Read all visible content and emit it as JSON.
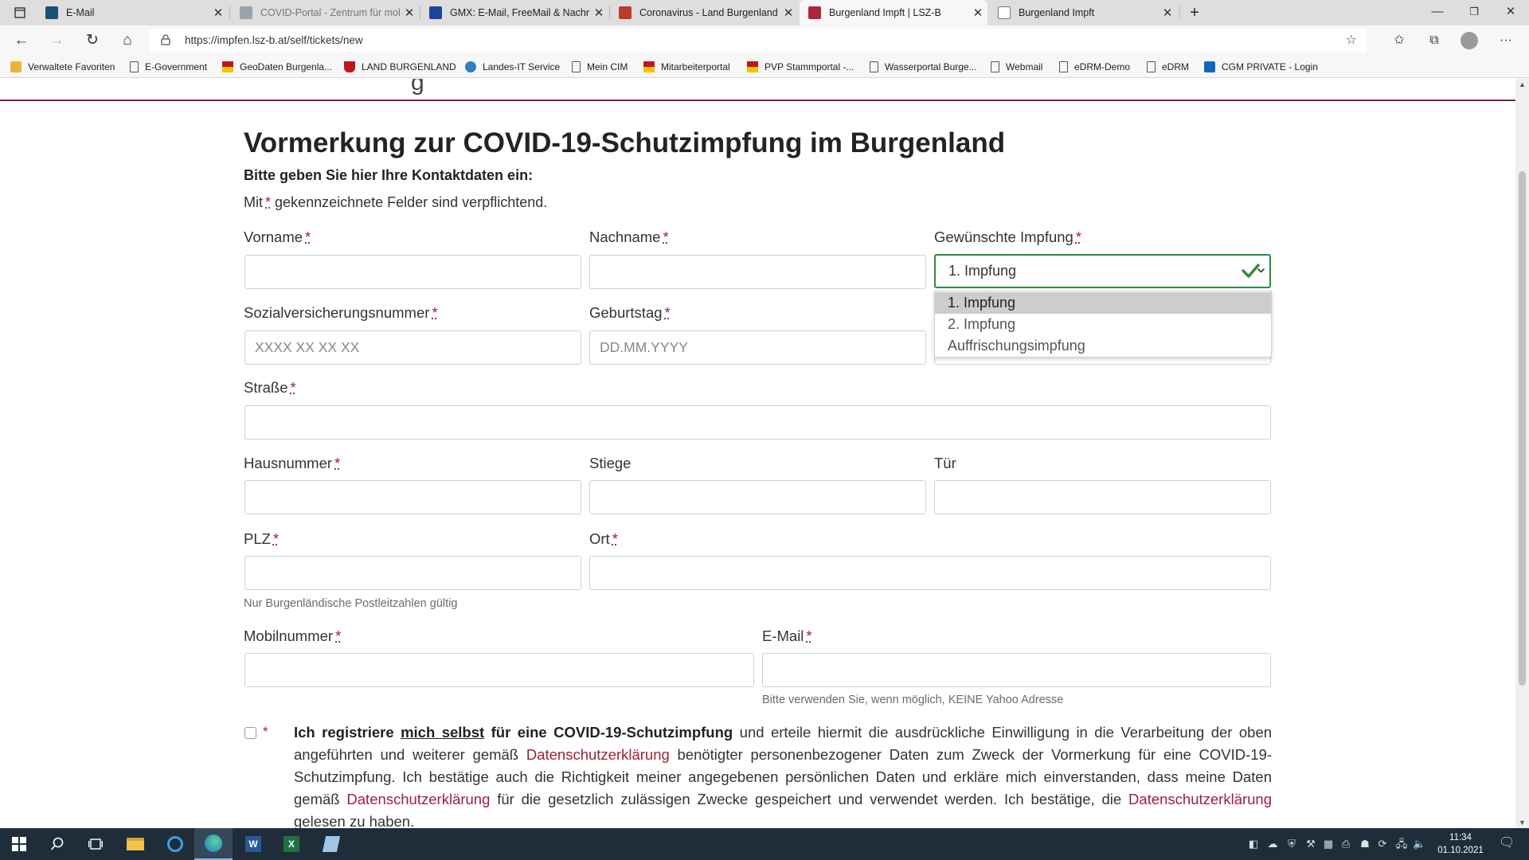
{
  "browser": {
    "tabs": [
      {
        "title": "E-Mail",
        "fav": "#1a5276"
      },
      {
        "title": "COVID-Portal - Zentrum für mol",
        "fav": "#9aa3ad"
      },
      {
        "title": "GMX: E-Mail, FreeMail & Nachric",
        "fav": "#1c449b"
      },
      {
        "title": "Coronavirus - Land Burgenland",
        "fav": "#c0392b"
      },
      {
        "title": "Burgenland Impft | LSZ-B",
        "fav": "#b0243a"
      },
      {
        "title": "Burgenland Impft",
        "fav": "#777777"
      }
    ],
    "url": "https://impfen.lsz-b.at/self/tickets/new",
    "bookmarks": [
      "Verwaltete Favoriten",
      "E-Government",
      "GeoDaten Burgenla...",
      "LAND BURGENLAND",
      "Landes-IT Service",
      "Mein CIM",
      "Mitarbeiterportal",
      "PVP Stammportal -...",
      "Wasserportal Burge...",
      "Webmail",
      "eDRM-Demo",
      "eDRM",
      "CGM PRIVATE - Login"
    ]
  },
  "page": {
    "header_fragment": "g",
    "title": "Vormerkung zur COVID-19-Schutzimpfung im Burgenland",
    "intro": "Bitte geben Sie hier Ihre Kontaktdaten ein:",
    "mandatory_prefix": "Mit",
    "mandatory_suffix": "gekennzeichnete Felder sind verpflichtend.",
    "required_mark": "*"
  },
  "form": {
    "vorname": {
      "label": "Vorname",
      "value": ""
    },
    "nachname": {
      "label": "Nachname",
      "value": ""
    },
    "impfung": {
      "label": "Gewünschte Impfung",
      "value": "1. Impfung",
      "options": [
        "1. Impfung",
        "2. Impfung",
        "Auffrischungsimpfung"
      ]
    },
    "svnr": {
      "label": "Sozialversicherungsnummer",
      "placeholder": "XXXX XX XX XX"
    },
    "geburtstag": {
      "label": "Geburtstag",
      "placeholder": "DD.MM.YYYY"
    },
    "strasse": {
      "label": "Straße"
    },
    "hausnummer": {
      "label": "Hausnummer"
    },
    "stiege": {
      "label": "Stiege"
    },
    "tuer": {
      "label": "Tür"
    },
    "plz": {
      "label": "PLZ",
      "help": "Nur Burgenländische Postleitzahlen gültig"
    },
    "ort": {
      "label": "Ort"
    },
    "mobil": {
      "label": "Mobilnummer"
    },
    "email": {
      "label": "E-Mail",
      "help": "Bitte verwenden Sie, wenn möglich, KEINE Yahoo Adresse"
    }
  },
  "consent": {
    "bold_1": "Ich registriere",
    "bold_underlined": "mich selbst",
    "bold_2": "für eine COVID-19-Schutzimpfung",
    "text_1": "und erteile hiermit die ausdrückliche Einwilligung in die Verarbeitung der oben angeführten und weiterer gemäß",
    "link": "Datenschutzerklärung",
    "text_2": "benötigter personenbezogener Daten zum Zweck der Vormerkung für eine COVID-19-Schutzimpfung. Ich bestätige auch die Richtigkeit meiner angegebenen persönlichen Daten und erkläre mich einverstanden, dass meine Daten gemäß",
    "text_3": "für die gesetzlich zulässigen Zwecke gespeichert und verwendet werden. Ich bestätige, die",
    "text_4": "gelesen zu haben."
  },
  "taskbar": {
    "time": "11:34",
    "date": "01.10.2021"
  },
  "colors": {
    "accent": "#a0203a",
    "valid": "#2e8b3e",
    "header_line": "#7a2a3a"
  }
}
